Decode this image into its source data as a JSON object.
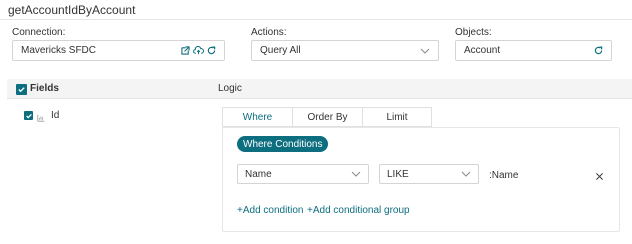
{
  "header": {
    "title": "getAccountIdByAccount"
  },
  "connection": {
    "label": "Connection:",
    "value": "Mavericks SFDC"
  },
  "actions": {
    "label": "Actions:",
    "value": "Query All"
  },
  "objects": {
    "label": "Objects:",
    "value": "Account"
  },
  "grid": {
    "fields_header": "Fields",
    "logic_header": "Logic",
    "rows": [
      {
        "name": "Id",
        "checked": true
      }
    ]
  },
  "tabs": [
    {
      "label": "Where",
      "active": true
    },
    {
      "label": "Order By",
      "active": false
    },
    {
      "label": "Limit",
      "active": false
    }
  ],
  "where": {
    "pill": "Where Conditions",
    "field": "Name",
    "operator": "LIKE",
    "value": ":Name",
    "add_condition": "+Add condition",
    "add_group": "+Add conditional group"
  },
  "colors": {
    "accent": "#0d6e7f",
    "border": "#d4d4d4",
    "header_bg": "#f4f4f4"
  },
  "icons": [
    "external-link-icon",
    "cloud-upload-icon",
    "refresh-icon",
    "chevron-down-icon",
    "checkbox-icon",
    "field-type-icon",
    "close-icon"
  ]
}
